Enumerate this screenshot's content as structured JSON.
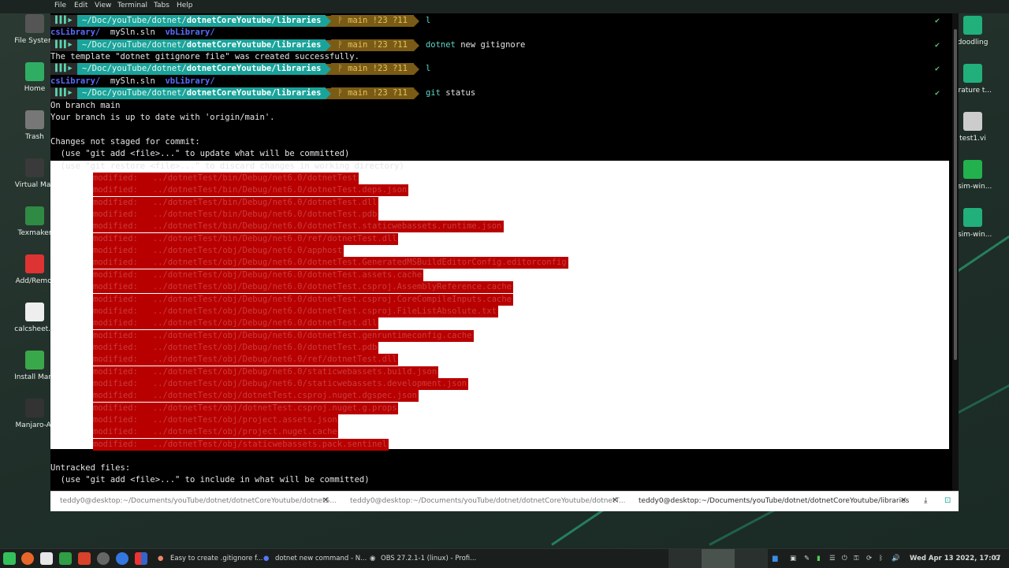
{
  "menubar": {
    "items": [
      "File",
      "Edit",
      "View",
      "Terminal",
      "Tabs",
      "Help"
    ]
  },
  "desktop_icons_left": [
    {
      "label": "File System",
      "icon": "disk-icon"
    },
    {
      "label": "Home",
      "icon": "home-folder-icon"
    },
    {
      "label": "Trash",
      "icon": "trash-icon"
    },
    {
      "label": "Virtual Mac",
      "icon": "vm-icon"
    },
    {
      "label": "Texmaker",
      "icon": "tex-icon"
    },
    {
      "label": "Add/Remo.",
      "icon": "add-remove-icon"
    },
    {
      "label": "calcsheet...",
      "icon": "spreadsheet-icon"
    },
    {
      "label": "Install Man.",
      "icon": "install-icon"
    },
    {
      "label": "Manjaro-Ar",
      "icon": "terminal-app-icon"
    }
  ],
  "desktop_icons_right": [
    {
      "label": "doodling",
      "icon": "folder-icon"
    },
    {
      "label": "erature t...",
      "icon": "folder-icon"
    },
    {
      "label": "test1.vi",
      "icon": "unknown-file-icon"
    },
    {
      "label": "vsim-win...",
      "icon": "zip-icon"
    },
    {
      "label": "vsim-win...",
      "icon": "folder-icon"
    }
  ],
  "prompt": {
    "path_prefix": "~/Doc/youTube/dotnet/",
    "path_bold": "dotnetCoreYoutube/libraries",
    "git": "ᚹ main !23 ?11",
    "check": "✔"
  },
  "lines": {
    "cmd1": "l",
    "ls1": {
      "dirs1": "csLibrary/",
      "file": "mySln.sln",
      "dirs2": "vbLibrary/"
    },
    "cmd2a": "dotnet",
    "cmd2b": " new gitignore",
    "out2": "The template \"dotnet gitignore file\" was created successfully.",
    "cmd3": "l",
    "ls2": {
      "dirs1": "csLibrary/",
      "file": "mySln.sln",
      "dirs2": "vbLibrary/"
    },
    "cmd4a": "git",
    "cmd4b": " status",
    "s1": "On branch main",
    "s2": "Your branch is up to date with 'origin/main'.",
    "s3": "Changes not staged for commit:",
    "s4": "  (use \"git add <file>...\" to update what will be committed)",
    "s5": "  (use \"git restore <file>...\" to discard changes in working directory)",
    "u1": "Untracked files:",
    "u2": "  (use \"git add <file>...\" to include in what will be committed)"
  },
  "modified_files": [
    "modified:   ../dotnetTest/bin/Debug/net6.0/dotnetTest",
    "modified:   ../dotnetTest/bin/Debug/net6.0/dotnetTest.deps.json",
    "modified:   ../dotnetTest/bin/Debug/net6.0/dotnetTest.dll",
    "modified:   ../dotnetTest/bin/Debug/net6.0/dotnetTest.pdb",
    "modified:   ../dotnetTest/bin/Debug/net6.0/dotnetTest.staticwebassets.runtime.json",
    "modified:   ../dotnetTest/bin/Debug/net6.0/ref/dotnetTest.dll",
    "modified:   ../dotnetTest/obj/Debug/net6.0/apphost",
    "modified:   ../dotnetTest/obj/Debug/net6.0/dotnetTest.GeneratedMSBuildEditorConfig.editorconfig",
    "modified:   ../dotnetTest/obj/Debug/net6.0/dotnetTest.assets.cache",
    "modified:   ../dotnetTest/obj/Debug/net6.0/dotnetTest.csproj.AssemblyReference.cache",
    "modified:   ../dotnetTest/obj/Debug/net6.0/dotnetTest.csproj.CoreCompileInputs.cache",
    "modified:   ../dotnetTest/obj/Debug/net6.0/dotnetTest.csproj.FileListAbsolute.txt",
    "modified:   ../dotnetTest/obj/Debug/net6.0/dotnetTest.dll",
    "modified:   ../dotnetTest/obj/Debug/net6.0/dotnetTest.genruntimeconfig.cache",
    "modified:   ../dotnetTest/obj/Debug/net6.0/dotnetTest.pdb",
    "modified:   ../dotnetTest/obj/Debug/net6.0/ref/dotnetTest.dll",
    "modified:   ../dotnetTest/obj/Debug/net6.0/staticwebassets.build.json",
    "modified:   ../dotnetTest/obj/Debug/net6.0/staticwebassets.development.json",
    "modified:   ../dotnetTest/obj/dotnetTest.csproj.nuget.dgspec.json",
    "modified:   ../dotnetTest/obj/dotnetTest.csproj.nuget.g.props",
    "modified:   ../dotnetTest/obj/project.assets.json",
    "modified:   ../dotnetTest/obj/project.nuget.cache",
    "modified:   ../dotnetTest/obj/staticwebassets.pack.sentinel"
  ],
  "tabs": [
    {
      "label": "teddy0@desktop:~/Documents/youTube/dotnet/dotnetCoreYoutube/dotnetS...",
      "active": false
    },
    {
      "label": "teddy0@desktop:~/Documents/youTube/dotnet/dotnetCoreYoutube/dotnetT...",
      "active": false
    },
    {
      "label": "teddy0@desktop:~/Documents/youTube/dotnet/dotnetCoreYoutube/libraries",
      "active": true
    }
  ],
  "taskbar": {
    "windows": [
      "Easy to create .gitignore f...",
      "dotnet new command - N...",
      "OBS 27.2.1-1 (linux) - Profi..."
    ],
    "clock": "Wed Apr 13 2022, 17:07"
  },
  "colors": {
    "prompt_path": "#1aa39a",
    "prompt_git": "#7a5b16",
    "highlight_red": "#b80000",
    "accent": "#2ec28a"
  }
}
